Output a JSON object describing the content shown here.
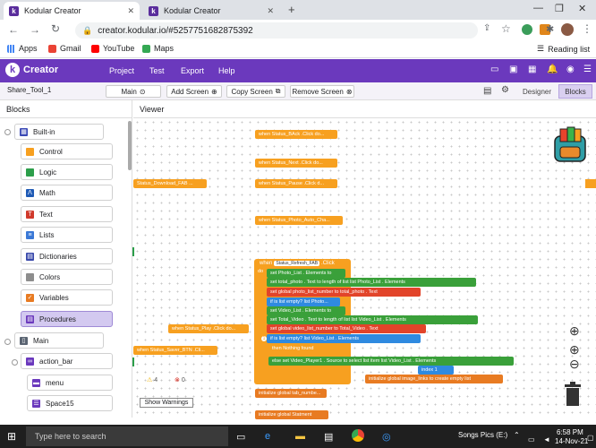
{
  "browser": {
    "tabs": [
      {
        "label": "Kodular Creator",
        "active": true
      },
      {
        "label": "Kodular Creator",
        "active": false
      }
    ],
    "new_tab_icon": "+",
    "url": "creator.kodular.io/#5257751682875392",
    "bookmarks": [
      "Apps",
      "Gmail",
      "YouTube",
      "Maps"
    ],
    "reading_list": "Reading list"
  },
  "kodular": {
    "logo_letter": "k",
    "app_name": "Creator",
    "menu": [
      "Project",
      "Test",
      "Export",
      "Help"
    ],
    "project_name": "Share_Tool_1",
    "screen": "Main",
    "add_screen": "Add Screen",
    "copy_screen": "Copy Screen",
    "remove_screen": "Remove Screen",
    "designer": "Designer",
    "blocks": "Blocks"
  },
  "panels": {
    "blocks_title": "Blocks",
    "viewer_title": "Viewer"
  },
  "tree": {
    "builtin": "Built-in",
    "items": [
      {
        "label": "Control",
        "color": "#f7a020",
        "icon": "control-icon"
      },
      {
        "label": "Logic",
        "color": "#2c9e4a",
        "icon": "logic-icon"
      },
      {
        "label": "Math",
        "color": "#1f5ab5",
        "icon": "math-icon"
      },
      {
        "label": "Text",
        "color": "#d0392b",
        "icon": "text-icon"
      },
      {
        "label": "Lists",
        "color": "#3a78d6",
        "icon": "lists-icon"
      },
      {
        "label": "Dictionaries",
        "color": "#3949ab",
        "icon": "dictionaries-icon"
      },
      {
        "label": "Colors",
        "color": "#8d8d8d",
        "icon": "colors-icon"
      },
      {
        "label": "Variables",
        "color": "#e87b22",
        "icon": "variables-icon"
      },
      {
        "label": "Procedures",
        "color": "#6b39bd",
        "icon": "procedures-icon"
      }
    ],
    "main": "Main",
    "components": [
      {
        "label": "action_bar",
        "icon": "link-icon"
      },
      {
        "label": "menu",
        "icon": "menu-icon"
      },
      {
        "label": "Space15",
        "icon": "space-icon"
      }
    ]
  },
  "workspace": {
    "events": [
      "when Status_BAck .Click do...",
      "when Status_Next .Click do...",
      "Status_Download_FAB ...",
      "when Status_Pause .Click d...",
      "when Status_Photo_Auto_Cha...",
      "when Status_Play .Click do...",
      "when Status_Saver_BTN .Cli..."
    ],
    "refresh": {
      "when": "when",
      "component": "Status_Refresh_FAB",
      "event": ".Click",
      "do": "do",
      "rows": [
        "set Photo_List . Elements to",
        "set total_photo . Text to  length of list list  Photo_List . Elements",
        "set global photo_list_number to  total_photo . Text",
        "if is list empty? list Photo...",
        "set Video_List . Elements to",
        "set Total_Video . Text to  length of list list  Video_List . Elements",
        "set global video_list_number to  Total_Video . Text",
        "if  is list empty? list  Video_List . Elements",
        "then  Nothing found",
        "else  set Video_Player1 . Source to  select list item list  Video_List . Elements",
        "index  1"
      ],
      "warn_badge": "1"
    },
    "init_links": "initialize global image_links to  create empty list",
    "init_tab": "initialize global tab_numbe...",
    "init_status": "initialize global Statment"
  },
  "warnings": {
    "warn_count": "4",
    "error_count": "0",
    "button": "Show Warnings"
  },
  "taskbar": {
    "search": "Type here to search",
    "tray_label": "Songs Pics (E:)",
    "time": "6:58 PM",
    "date": "14-Nov-21"
  }
}
